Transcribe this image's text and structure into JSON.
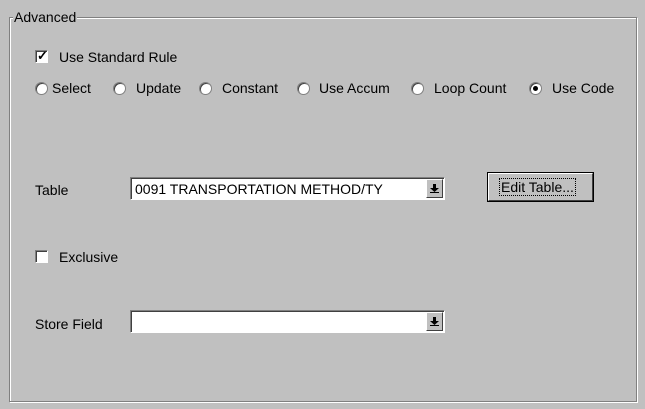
{
  "group": {
    "title": "Advanced"
  },
  "use_standard_rule": {
    "label": "Use Standard Rule",
    "checked": true
  },
  "rule_type": {
    "options": [
      {
        "label": "Select",
        "selected": false
      },
      {
        "label": "Update",
        "selected": false
      },
      {
        "label": "Constant",
        "selected": false
      },
      {
        "label": "Use Accum",
        "selected": false
      },
      {
        "label": "Loop Count",
        "selected": false
      },
      {
        "label": "Use Code",
        "selected": true
      }
    ]
  },
  "table": {
    "label": "Table",
    "value": "0091 TRANSPORTATION METHOD/TY",
    "dropdown_icon": "dropdown-arrow-icon",
    "edit_button_label": "Edit Table..."
  },
  "exclusive": {
    "label": "Exclusive",
    "checked": false
  },
  "store_field": {
    "label": "Store Field",
    "value": "",
    "dropdown_icon": "dropdown-arrow-icon"
  }
}
